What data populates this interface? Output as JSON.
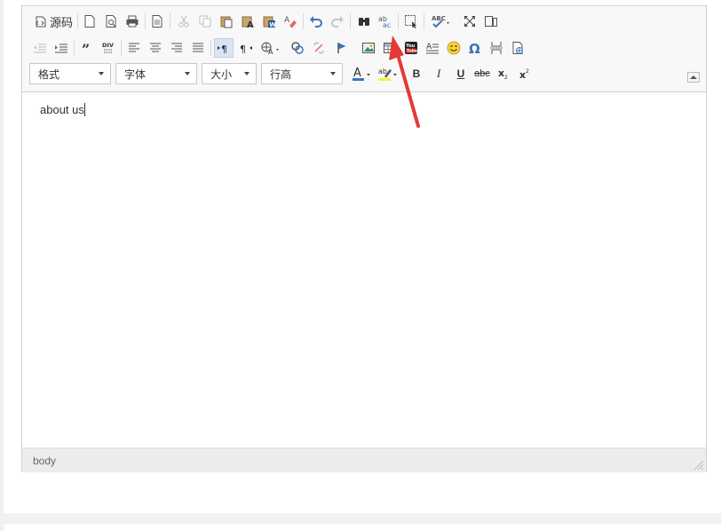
{
  "toolbar": {
    "source_label": "源码",
    "format_combo": "格式",
    "font_combo": "字体",
    "size_combo": "大小",
    "lineheight_combo": "行高",
    "bold": "B",
    "italic": "I",
    "underline": "U",
    "strike": "abc"
  },
  "content": {
    "text": "about us"
  },
  "statusbar": {
    "path": "body"
  },
  "colors": {
    "accent": "#e53935",
    "toolbar_bg": "#f8f8f8",
    "icon": "#4a4a4a",
    "blue": "#3b73b9"
  }
}
